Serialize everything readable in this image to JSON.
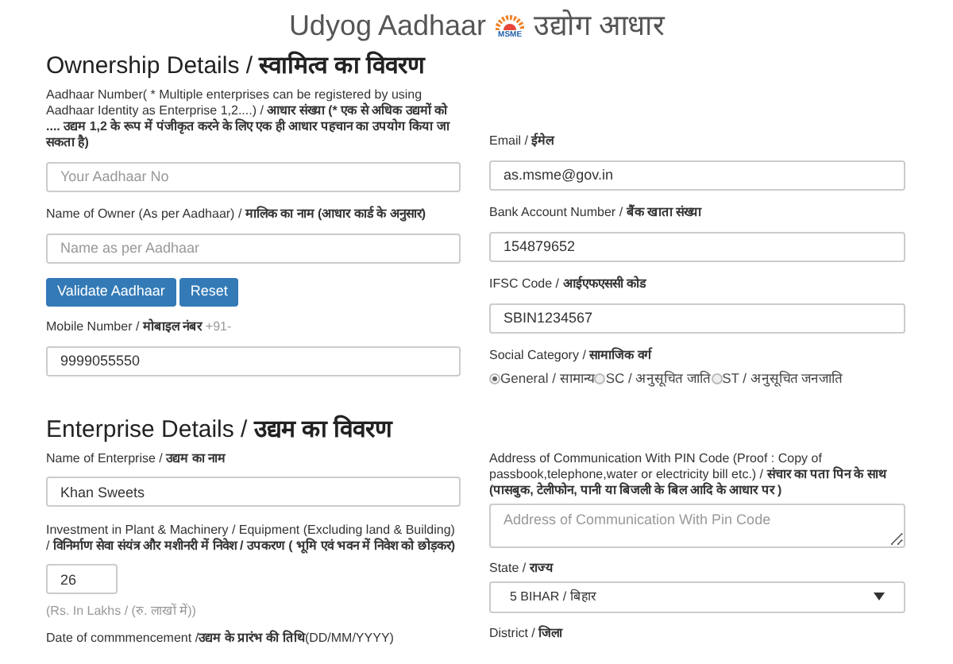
{
  "header": {
    "title": "Udyog Aadhaar",
    "logo_text": "MSME",
    "title_hindi": "उद्योग आधार"
  },
  "sections": [
    {
      "heading": "Ownership Details / **स्वामित्व का विवरण**",
      "left": [
        {
          "kind": "input",
          "label": "Aadhaar Number( * Multiple enterprises can be registered by using Aadhaar Identity as Enterprise 1,2....) / **आधार संख्या (* एक से अधिक उद्यमों को .... उद्यम 1,2 के रूप में पंजीकृत करने के लिए एक ही आधार पहचान का उपयोग किया जा सकता है)**",
          "placeholder": "Your Aadhaar No"
        },
        {
          "kind": "input",
          "label": "Name of Owner (As per Aadhaar) / **मालिक का नाम (आधार कार्ड के अनुसार)**",
          "placeholder": "Name as per Aadhaar"
        },
        {
          "kind": "buttons",
          "buttons": [
            "Validate Aadhaar",
            "Reset"
          ]
        },
        {
          "kind": "input",
          "label": "Mobile Number / **मोबाइल नंबर**",
          "suffix": "+91-",
          "value": "9999055550"
        }
      ],
      "right": [
        {
          "kind": "input",
          "label": "Email / **ईमेल**",
          "value": "as.msme@gov.in"
        },
        {
          "kind": "input",
          "label": "Bank Account Number / **बैंक खाता संख्या**",
          "value": "154879652"
        },
        {
          "kind": "input",
          "label": "IFSC Code / **आईएफएससी कोड**",
          "value": "SBIN1234567"
        },
        {
          "kind": "radio",
          "label": "Social Category / **सामाजिक वर्ग**",
          "options": [
            {
              "label": "General / सामान्य",
              "selected": true
            },
            {
              "label": "SC / अनुसूचित जाति",
              "selected": false
            },
            {
              "label": "ST / अनुसूचित जनजाति",
              "selected": false
            }
          ]
        }
      ]
    },
    {
      "heading": "Enterprise Details / **उद्यम का विवरण**",
      "left": [
        {
          "kind": "input",
          "label": "Name of Enterprise / **उद्यम का नाम**",
          "value": "Khan Sweets"
        },
        {
          "kind": "short_input",
          "label": "Investment in Plant & Machinery / Equipment (Excluding land & Building) / **विनिर्माण सेवा संयंत्र और मशीनरी में निवेश / उपकरण ( भूमि एवं भवन में निवेश को छोड़कर)**",
          "value": "26",
          "note": "(Rs. In Lakhs / (रु. लाखों में))"
        },
        {
          "kind": "label",
          "label": "Date of commmencement /**उद्यम के प्रारंभ की तिथि**(DD/MM/YYYY)"
        }
      ],
      "right": [
        {
          "kind": "textarea",
          "label": "Address of Communication With PIN Code (Proof : Copy of passbook,telephone,water or electricity bill etc.) / **संचार का पता पिन के साथ (पासबुक, टेलीफोन, पानी या बिजली के बिल आदि के आधार पर )**",
          "placeholder": "Address of Communication With Pin Code"
        },
        {
          "kind": "select",
          "label": "State / **राज्य**",
          "value": "5 BIHAR / बिहार"
        },
        {
          "kind": "label",
          "label": "District / **जिला**"
        }
      ]
    }
  ]
}
